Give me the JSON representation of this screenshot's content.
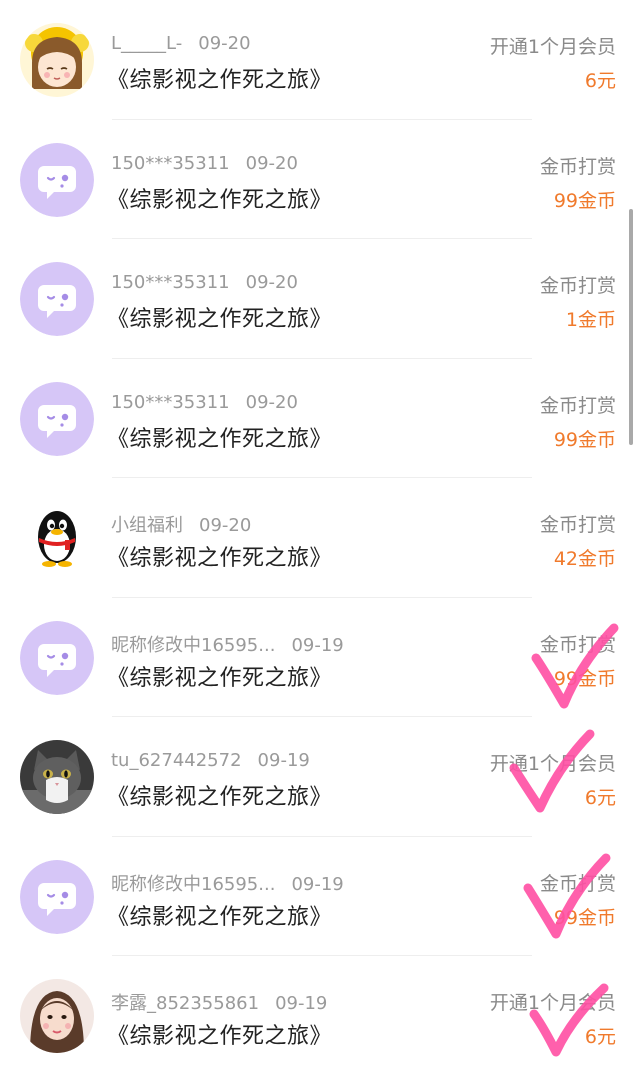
{
  "rows": [
    {
      "name": "L_____L-",
      "date": "09-20",
      "title": "《综影视之作死之旅》",
      "type": "开通1个月会员",
      "amount": "6元",
      "avatar": "girl-cartoon-avatar"
    },
    {
      "name": "150***35311",
      "date": "09-20",
      "title": "《综影视之作死之旅》",
      "type": "金币打赏",
      "amount": "99金币",
      "avatar": "default-chat-avatar"
    },
    {
      "name": "150***35311",
      "date": "09-20",
      "title": "《综影视之作死之旅》",
      "type": "金币打赏",
      "amount": "1金币",
      "avatar": "default-chat-avatar"
    },
    {
      "name": "150***35311",
      "date": "09-20",
      "title": "《综影视之作死之旅》",
      "type": "金币打赏",
      "amount": "99金币",
      "avatar": "default-chat-avatar"
    },
    {
      "name": "小组福利",
      "date": "09-20",
      "title": "《综影视之作死之旅》",
      "type": "金币打赏",
      "amount": "42金币",
      "avatar": "penguin-avatar"
    },
    {
      "name": "昵称修改中16595...",
      "date": "09-19",
      "title": "《综影视之作死之旅》",
      "type": "金币打赏",
      "amount": "99金币",
      "avatar": "default-chat-avatar"
    },
    {
      "name": "tu_627442572",
      "date": "09-19",
      "title": "《综影视之作死之旅》",
      "type": "开通1个月会员",
      "amount": "6元",
      "avatar": "cat-photo-avatar"
    },
    {
      "name": "昵称修改中16595...",
      "date": "09-19",
      "title": "《综影视之作死之旅》",
      "type": "金币打赏",
      "amount": "99金币",
      "avatar": "default-chat-avatar"
    },
    {
      "name": "李露_852355861",
      "date": "09-19",
      "title": "《综影视之作死之旅》",
      "type": "开通1个月会员",
      "amount": "6元",
      "avatar": "girl-photo-avatar"
    }
  ],
  "colors": {
    "amount": "#f07a2c",
    "meta": "#9a9a9a",
    "check_mark": "#ff4fa3",
    "default_avatar": "#d6c6f7"
  }
}
